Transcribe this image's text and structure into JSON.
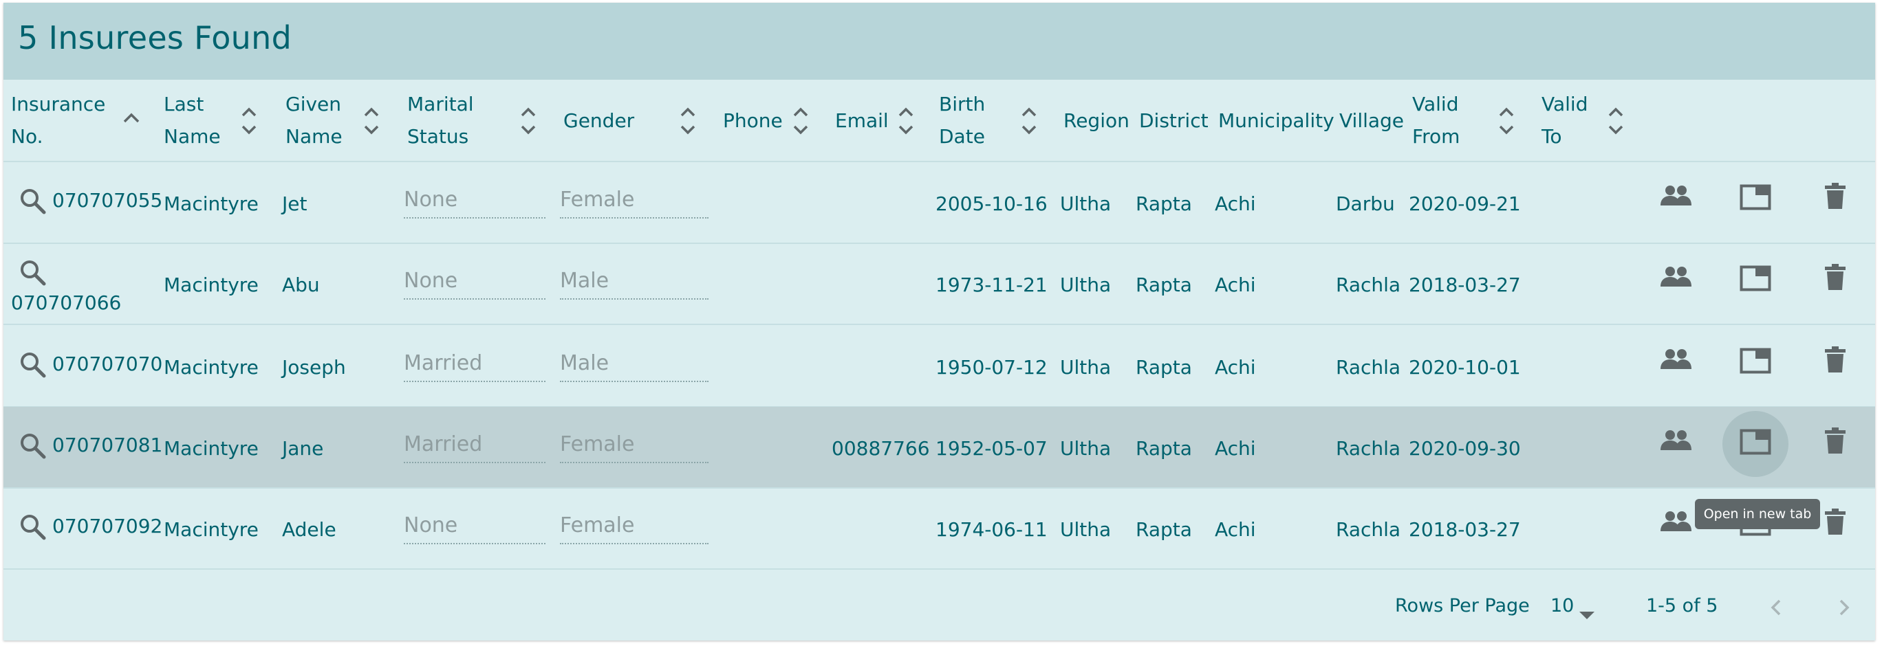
{
  "page": {
    "title": "5 Insurees Found"
  },
  "columns": {
    "insurance_no": [
      "Insurance",
      "No."
    ],
    "last_name": [
      "Last",
      "Name"
    ],
    "given_name": [
      "Given",
      "Name"
    ],
    "marital_status": [
      "Marital",
      "Status"
    ],
    "gender": "Gender",
    "phone": "Phone",
    "email": "Email",
    "birth_date": [
      "Birth",
      "Date"
    ],
    "region": "Region",
    "district": "District",
    "municipality": "Municipality",
    "village": "Village",
    "valid_from": [
      "Valid",
      "From"
    ],
    "valid_to": [
      "Valid",
      "To"
    ]
  },
  "rows": [
    {
      "insurance_no": "070707055",
      "last_name": "Macintyre",
      "given_name": "Jet",
      "marital_status": "None",
      "gender": "Female",
      "phone": "",
      "email": "",
      "birth_date": "2005-10-16",
      "region": "Ultha",
      "district": "Rapta",
      "municipality": "Achi",
      "village": "Darbu",
      "valid_from": "2020-09-21",
      "valid_to": ""
    },
    {
      "insurance_no": "070707066",
      "last_name": "Macintyre",
      "given_name": "Abu",
      "marital_status": "None",
      "gender": "Male",
      "phone": "",
      "email": "",
      "birth_date": "1973-11-21",
      "region": "Ultha",
      "district": "Rapta",
      "municipality": "Achi",
      "village": "Rachla",
      "valid_from": "2018-03-27",
      "valid_to": ""
    },
    {
      "insurance_no": "070707070",
      "last_name": "Macintyre",
      "given_name": "Joseph",
      "marital_status": "Married",
      "gender": "Male",
      "phone": "",
      "email": "",
      "birth_date": "1950-07-12",
      "region": "Ultha",
      "district": "Rapta",
      "municipality": "Achi",
      "village": "Rachla",
      "valid_from": "2020-10-01",
      "valid_to": ""
    },
    {
      "insurance_no": "070707081",
      "last_name": "Macintyre",
      "given_name": "Jane",
      "marital_status": "Married",
      "gender": "Female",
      "phone": "",
      "email": "00887766",
      "birth_date": "1952-05-07",
      "region": "Ultha",
      "district": "Rapta",
      "municipality": "Achi",
      "village": "Rachla",
      "valid_from": "2020-09-30",
      "valid_to": ""
    },
    {
      "insurance_no": "070707092",
      "last_name": "Macintyre",
      "given_name": "Adele",
      "marital_status": "None",
      "gender": "Female",
      "phone": "",
      "email": "",
      "birth_date": "1974-06-11",
      "region": "Ultha",
      "district": "Rapta",
      "municipality": "Achi",
      "village": "Rachla",
      "valid_from": "2018-03-27",
      "valid_to": ""
    }
  ],
  "row_actions": {
    "family": "people-icon",
    "open_new_tab": "open-in-new-tab-icon",
    "delete": "trash-icon"
  },
  "tooltip": "Open in new tab",
  "footer": {
    "rows_per_page_label": "Rows Per Page",
    "rows_per_page_value": "10",
    "range": "1-5 of 5"
  },
  "colors": {
    "primary_text": "#00626e",
    "title_bar": "#b7d5d9",
    "table_bg": "#dbeef0",
    "selected_row": "#bfd2d5",
    "icon": "#5f6769"
  }
}
